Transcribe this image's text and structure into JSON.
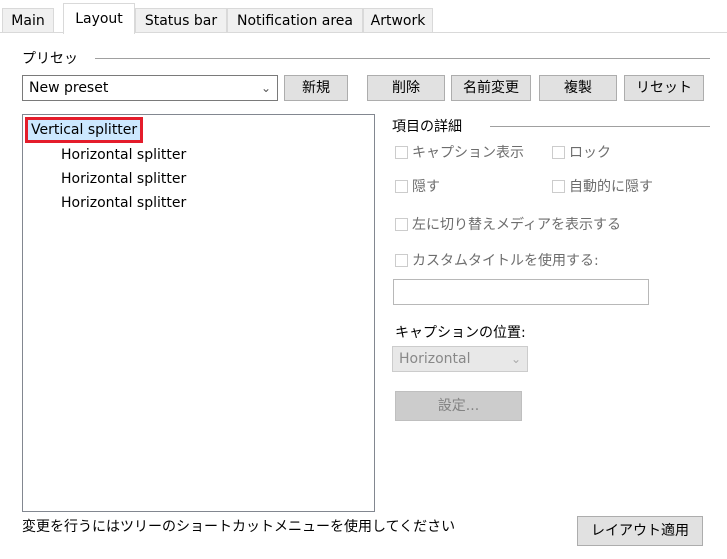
{
  "tabs": [
    {
      "label": "Main",
      "active": false
    },
    {
      "label": "Layout",
      "active": true
    },
    {
      "label": "Status bar",
      "active": false
    },
    {
      "label": "Notification area",
      "active": false
    },
    {
      "label": "Artwork",
      "active": false
    }
  ],
  "preset": {
    "group_label": "プリセッ",
    "selected": "New preset",
    "buttons": {
      "new": "新規",
      "delete": "削除",
      "rename": "名前変更",
      "duplicate": "複製",
      "reset": "リセット"
    }
  },
  "tree": {
    "root": "Vertical splitter",
    "children": [
      "Horizontal splitter",
      "Horizontal splitter",
      "Horizontal splitter"
    ]
  },
  "details": {
    "group_label": "項目の詳細",
    "show_caption": "キャプション表示",
    "lock": "ロック",
    "hide": "隠す",
    "auto_hide": "自動的に隠す",
    "toggle_left_media": "左に切り替えメディアを表示する",
    "use_custom_title": "カスタムタイトルを使用する:",
    "custom_title_value": "",
    "caption_position_label": "キャプションの位置:",
    "caption_position_value": "Horizontal",
    "settings_button": "設定..."
  },
  "footer": {
    "hint": "変更を行うにはツリーのショートカットメニューを使用してください",
    "apply_button": "レイアウト適用"
  }
}
